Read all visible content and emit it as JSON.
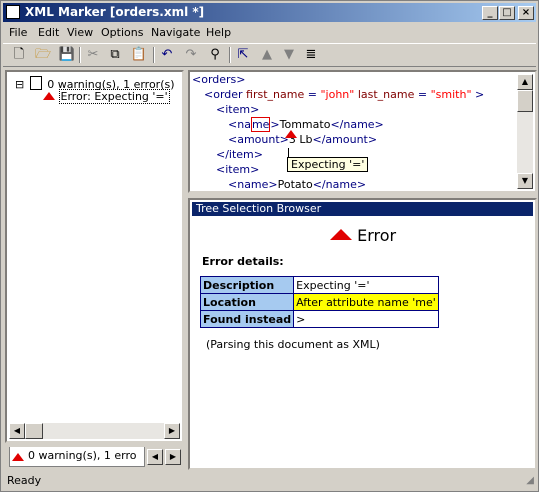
{
  "window": {
    "title": "XML Marker  [orders.xml *]",
    "min": "_",
    "max": "□",
    "close": "×"
  },
  "menu": [
    "File",
    "Edit",
    "View",
    "Options",
    "Navigate",
    "Help"
  ],
  "tree": {
    "root_label": "0 warning(s), 1 error(s)",
    "expander": "⊟",
    "error_item": "Error: Expecting '='"
  },
  "code": {
    "lines": [
      {
        "indent": 0,
        "parts": [
          [
            "tag",
            "<orders>"
          ]
        ]
      },
      {
        "indent": 1,
        "parts": [
          [
            "tag",
            "<order "
          ],
          [
            "attr",
            "first_name"
          ],
          [
            "tag",
            " = "
          ],
          [
            "val",
            "\"john\""
          ],
          [
            "attr",
            " last_name"
          ],
          [
            "tag",
            " = "
          ],
          [
            "val",
            "\"smith\""
          ],
          [
            "tag",
            " >"
          ]
        ]
      },
      {
        "indent": 2,
        "parts": [
          [
            "tag",
            "<item>"
          ]
        ]
      },
      {
        "indent": 3,
        "parts": [
          [
            "tag",
            "<na"
          ],
          [
            "err",
            "me"
          ],
          [
            "tag",
            ">"
          ],
          [
            "txt",
            "Tommato"
          ],
          [
            "tag",
            "</name>"
          ]
        ]
      },
      {
        "indent": 3,
        "parts": [
          [
            "tag",
            "<amount>"
          ],
          [
            "txt",
            "3 Lb"
          ],
          [
            "tag",
            "</amount>"
          ]
        ]
      },
      {
        "indent": 2,
        "parts": [
          [
            "tag",
            "</item>"
          ]
        ]
      },
      {
        "indent": 2,
        "parts": [
          [
            "tag",
            "<item>"
          ]
        ]
      },
      {
        "indent": 3,
        "parts": [
          [
            "tag",
            "<name>"
          ],
          [
            "txt",
            "Potato"
          ],
          [
            "tag",
            "</name>"
          ]
        ]
      }
    ],
    "tooltip": "Expecting '='"
  },
  "browser": {
    "header": "Tree Selection Browser",
    "title": "Error",
    "details_label": "Error details:",
    "rows": [
      {
        "key": "Description",
        "value": "Expecting '='"
      },
      {
        "key": "Location",
        "value": "After attribute name 'me'"
      },
      {
        "key": "Found instead",
        "value": ">"
      }
    ],
    "note": "(Parsing this document as XML)"
  },
  "bottom_tab": "0 warning(s), 1 erro",
  "status": "Ready",
  "colors": {
    "error_red": "#e00000",
    "title_blue": "#0a246a",
    "highlight_yellow": "#ffff00"
  }
}
